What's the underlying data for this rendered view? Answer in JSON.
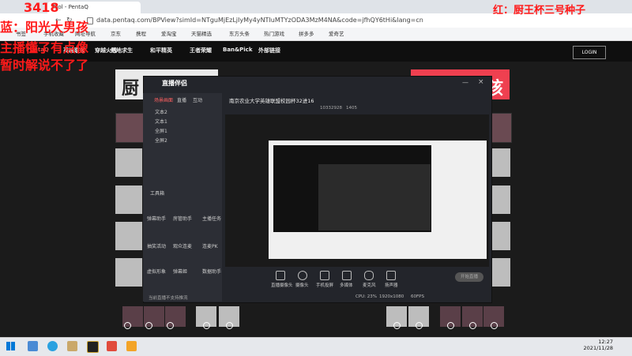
{
  "browser": {
    "tab_title": "Tool - PentaQ",
    "url": "data.pentaq.com/BPView?simId=NTguMjEzLjIyMy4yNTIuMTYzODA3MzM4NA&code=jfhQY6tHi&lang=cn",
    "bookmarks": [
      "书签",
      "手机收藏",
      "网址导航",
      "京东",
      "携程",
      "爱淘宝",
      "天猫精选",
      "东方头条",
      "热门游戏",
      "拼多多",
      "爱奇艺"
    ]
  },
  "site": {
    "logo": "PentaQ",
    "nav": [
      "英雄联盟",
      "穿越火线",
      "绝地求生",
      "和平精英",
      "王者荣耀",
      "Ban&Pick",
      "外部链接"
    ],
    "login_label": "LOGIN",
    "banner_left": "厨",
    "banner_right": "孩"
  },
  "overlays": {
    "right_text": "红：厨王杯三号种子",
    "left_lines": [
      "3418",
      "蓝：阳光大男孩",
      "主播懂了有点像",
      "暂时解说不了了"
    ],
    "user_id": "10332928"
  },
  "obs": {
    "app_name": "直播伴侣",
    "left_tabs": [
      "场景画面",
      "直播",
      "互动"
    ],
    "sources": [
      "文本2",
      "文本1",
      "全屏1",
      "全屏2"
    ],
    "tools_title": "工具箱",
    "tools": [
      "弹幕助手",
      "房管助手",
      "主播任务",
      "抽奖活动",
      "观众连麦",
      "连麦PK",
      "虚拟形象",
      "弹幕姬",
      "数据助手"
    ],
    "stream_title": "南京农业大学英雄联盟校园杯32进16",
    "room_id": "10332928",
    "viewer_count": "1405",
    "bottom_tools": [
      "直播摄像头",
      "摄像头",
      "手机投屏",
      "多媒体",
      "麦克风",
      "扬声器"
    ],
    "start_live": "开始直播",
    "status_items": [
      "CPU: 23%",
      "1920x1080",
      "60FPS"
    ],
    "notice": "当前直播不支持推流"
  },
  "taskbar": {
    "time": "12:27",
    "date": "2021/11/28"
  }
}
